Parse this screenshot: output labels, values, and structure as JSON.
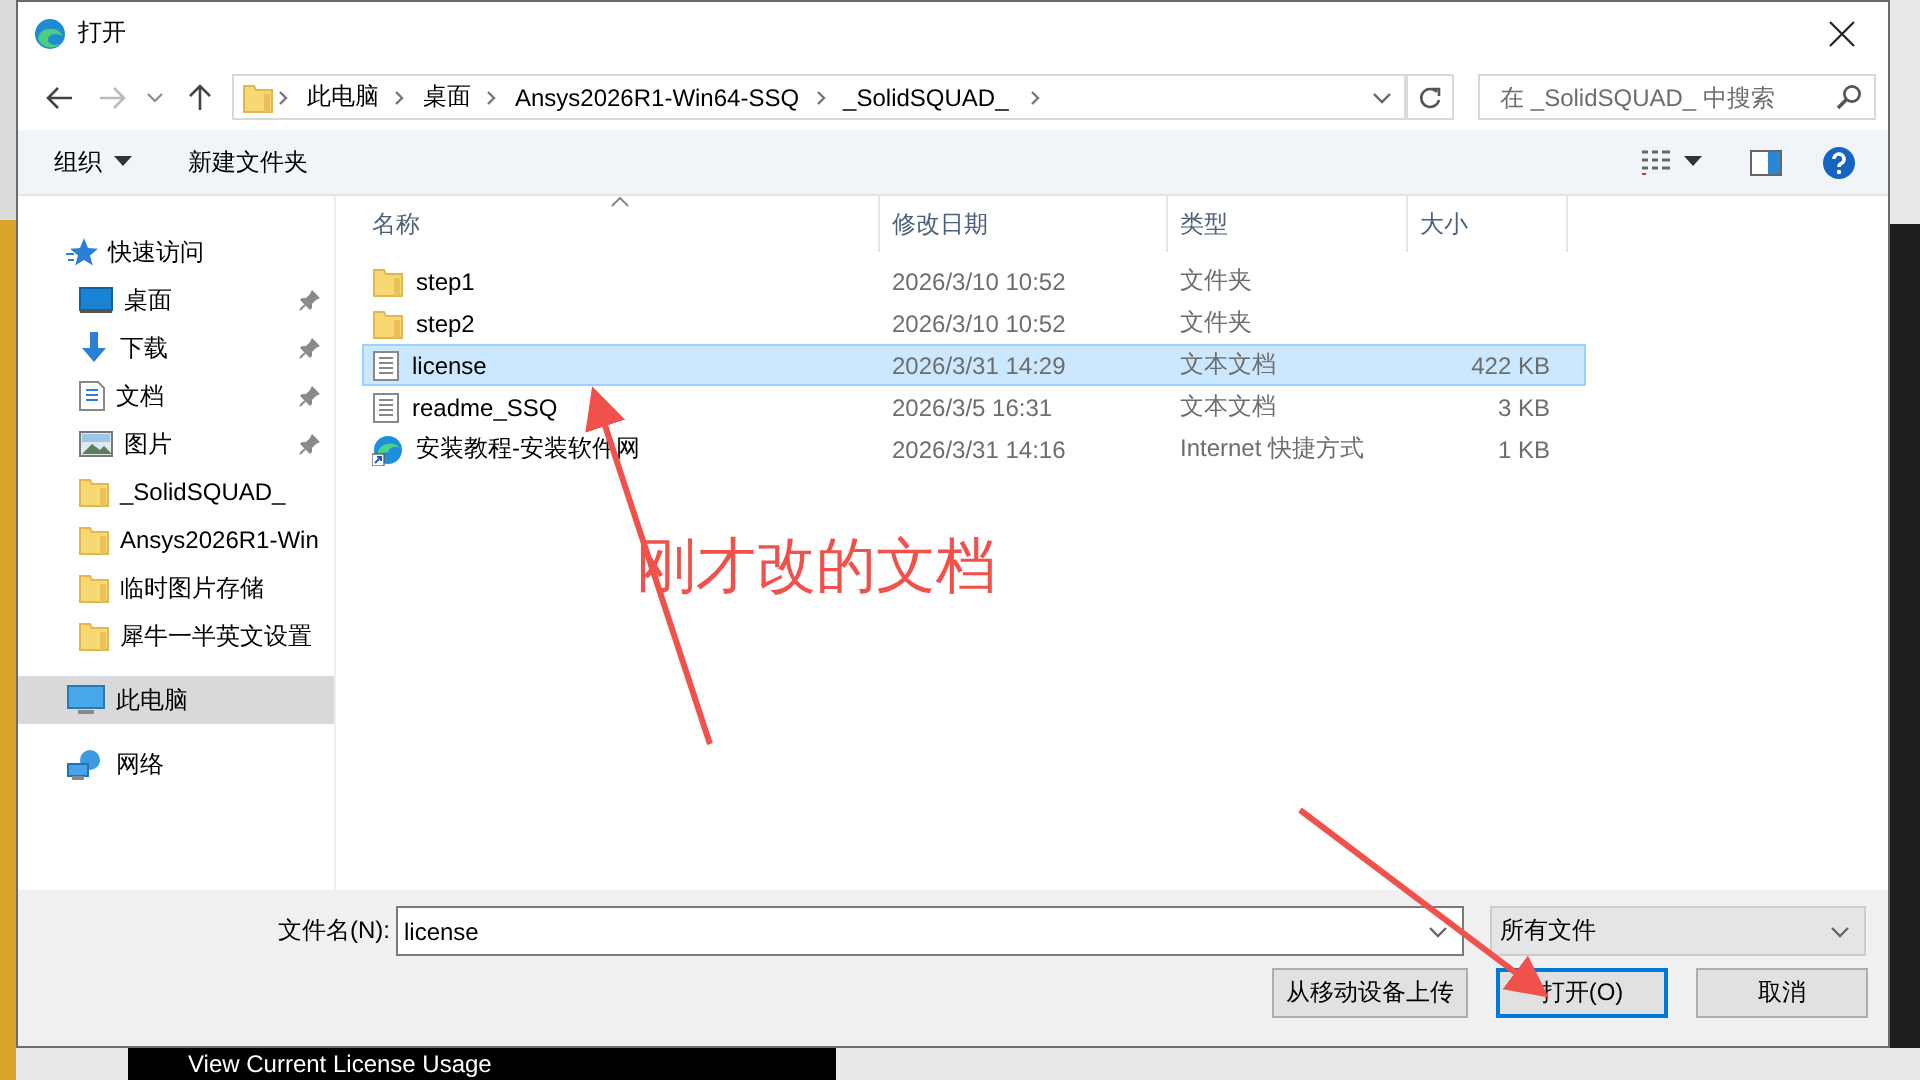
{
  "window": {
    "title": "打开"
  },
  "address": {
    "crumbs": [
      "此电脑",
      "桌面",
      "Ansys2026R1-Win64-SSQ",
      "_SolidSQUAD_"
    ]
  },
  "search": {
    "placeholder": "在 _SolidSQUAD_ 中搜索"
  },
  "toolbar": {
    "organize": "组织",
    "new_folder": "新建文件夹"
  },
  "sidebar": {
    "items": [
      {
        "label": "快速访问",
        "kind": "star",
        "selected": false,
        "children": [
          {
            "label": "桌面",
            "kind": "desktop",
            "pinned": true,
            "selected": false
          },
          {
            "label": "下载",
            "kind": "download",
            "pinned": true,
            "selected": false
          },
          {
            "label": "文档",
            "kind": "document",
            "pinned": true,
            "selected": false
          },
          {
            "label": "图片",
            "kind": "picture",
            "pinned": true,
            "selected": false
          },
          {
            "label": "_SolidSQUAD_",
            "kind": "folder",
            "pinned": false,
            "selected": false
          },
          {
            "label": "Ansys2026R1-Win",
            "kind": "folder",
            "pinned": false,
            "selected": false
          },
          {
            "label": "临时图片存储",
            "kind": "folder",
            "pinned": false,
            "selected": false
          },
          {
            "label": "犀牛一半英文设置",
            "kind": "folder",
            "pinned": false,
            "selected": false
          }
        ]
      },
      {
        "label": "此电脑",
        "kind": "pc",
        "selected": true
      },
      {
        "label": "网络",
        "kind": "network",
        "selected": false
      }
    ]
  },
  "table": {
    "columns": [
      {
        "label": "名称",
        "sorted": true
      },
      {
        "label": "修改日期",
        "sorted": false
      },
      {
        "label": "类型",
        "sorted": false
      },
      {
        "label": "大小",
        "sorted": false
      }
    ],
    "rows": [
      {
        "name": "step1",
        "date": "2026/3/10 10:52",
        "type": "文件夹",
        "size": "",
        "kind": "folder",
        "selected": false
      },
      {
        "name": "step2",
        "date": "2026/3/10 10:52",
        "type": "文件夹",
        "size": "",
        "kind": "folder",
        "selected": false
      },
      {
        "name": "license",
        "date": "2026/3/31 14:29",
        "type": "文本文档",
        "size": "422 KB",
        "kind": "text",
        "selected": true
      },
      {
        "name": "readme_SSQ",
        "date": "2026/3/5 16:31",
        "type": "文本文档",
        "size": "3 KB",
        "kind": "text",
        "selected": false
      },
      {
        "name": "安装教程-安装软件网",
        "date": "2026/3/31 14:16",
        "type": "Internet 快捷方式",
        "size": "1 KB",
        "kind": "shortcut",
        "selected": false
      }
    ]
  },
  "footer": {
    "filename_label": "文件名(N):",
    "filename": "license",
    "filter": "所有文件",
    "buttons": [
      {
        "label": "从移动设备上传",
        "default": false
      },
      {
        "label": "打开(O)",
        "default": true
      },
      {
        "label": "取消",
        "default": false
      }
    ]
  },
  "annotation": {
    "text": "刚才改的文档"
  },
  "background": {
    "button": "View Current License Usage"
  }
}
